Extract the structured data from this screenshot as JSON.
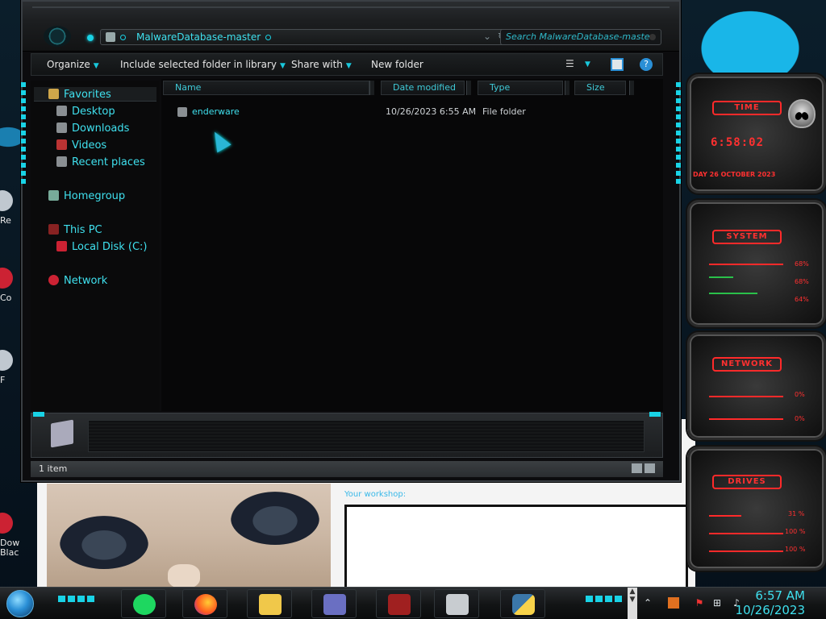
{
  "window": {
    "address_path": "MalwareDatabase-master",
    "search_placeholder": "Search MalwareDatabase-master"
  },
  "toolbar": {
    "organize": "Organize",
    "include_library": "Include selected folder in library",
    "share_with": "Share with",
    "new_folder": "New folder"
  },
  "nav": {
    "favorites": "Favorites",
    "desktop": "Desktop",
    "downloads": "Downloads",
    "videos": "Videos",
    "recent_places": "Recent places",
    "homegroup": "Homegroup",
    "this_pc": "This PC",
    "local_disk": "Local Disk (C:)",
    "network": "Network"
  },
  "columns": {
    "name": "Name",
    "date_modified": "Date modified",
    "type": "Type",
    "size": "Size"
  },
  "files": [
    {
      "name": "enderware",
      "date": "10/26/2023 6:55 AM",
      "type": "File folder",
      "size": ""
    }
  ],
  "status": {
    "item_count": "1 item"
  },
  "browser": {
    "workshop_label": "Your workshop:"
  },
  "widgets": {
    "time": {
      "title": "TIME",
      "clock": "6:58:02",
      "date": "DAY 26 OCTOBER 2023"
    },
    "system": {
      "title": "SYSTEM",
      "v1": "68%",
      "v2": "68%",
      "v3": "64%"
    },
    "network": {
      "title": "NETWORK",
      "v1": "0%",
      "v2": "0%"
    },
    "drives": {
      "title": "DRIVES",
      "v1": "31 %",
      "v2": "100 %",
      "v3": "100 %"
    }
  },
  "desktop_icons": [
    {
      "label": "Re"
    },
    {
      "label": "Co"
    },
    {
      "label": "F"
    },
    {
      "label": "Dow Blac"
    }
  ],
  "taskbar": {
    "clock_time": "6:57 AM",
    "clock_date": "10/26/2023",
    "apps": [
      "spotify-icon",
      "firefox-icon",
      "file-explorer-icon",
      "card-icon",
      "terminal-icon",
      "archive-icon",
      "python-icon"
    ]
  },
  "colors": {
    "accent_cyan": "#19d3e6",
    "widget_red": "#ff3030"
  }
}
